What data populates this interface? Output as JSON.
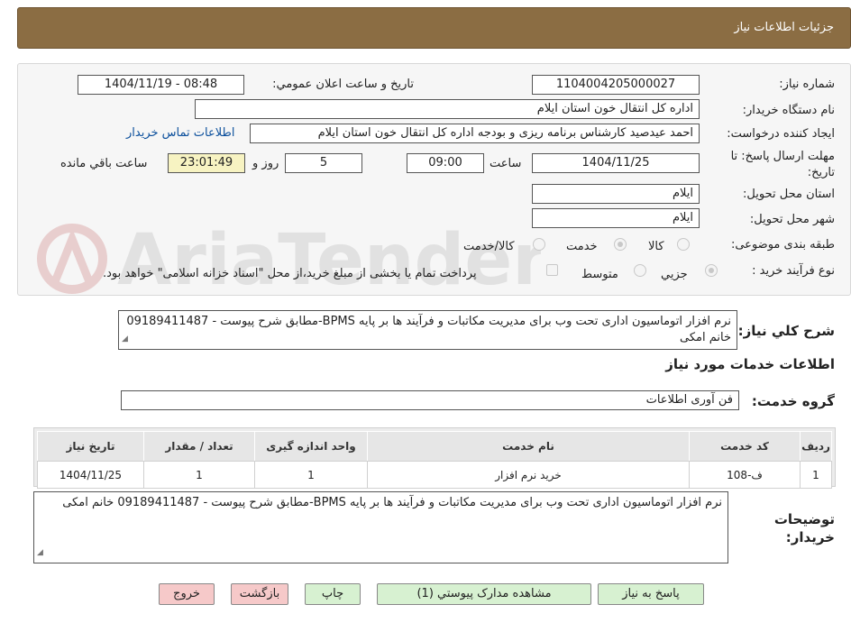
{
  "header": {
    "title": "جزئیات اطلاعات نیاز"
  },
  "form": {
    "need_number_label": "شماره نیاز:",
    "need_number": "1104004205000027",
    "announce_label": "تاریخ و ساعت اعلان عمومي:",
    "announce_value": "1404/11/19 - 08:48",
    "buyer_org_label": "نام دستگاه خریدار:",
    "buyer_org": "اداره کل انتقال خون استان ایلام",
    "requester_label": "ایجاد کننده درخواست:",
    "requester": "احمد عیدصید کارشناس برنامه ریزی و بودجه اداره کل انتقال خون استان ایلام",
    "contact_link": "اطلاعات تماس خریدار",
    "deadline_label": "مهلت ارسال پاسخ: تا تاریخ:",
    "deadline_date": "1404/11/25",
    "time_label": "ساعت",
    "deadline_time": "09:00",
    "days": "5",
    "days_label": "روز و",
    "remaining": "23:01:49",
    "remaining_label": "ساعت باقي مانده",
    "province_label": "استان محل تحویل:",
    "province": "ایلام",
    "city_label": "شهر محل تحویل:",
    "city": "ایلام",
    "category_label": "طبقه بندی موضوعی:",
    "category_options": [
      "کالا",
      "خدمت",
      "کالا/خدمت"
    ],
    "process_label": "نوع فرآیند خرید :",
    "process_options": [
      "جزیي",
      "متوسط"
    ],
    "payment_note": "پرداخت تمام یا بخشی از مبلغ خرید،از محل \"اسناد خزانه اسلامی\" خواهد بود."
  },
  "summary": {
    "label": "شرح کلي نیاز:",
    "text": "نرم افزار اتوماسیون اداری تحت وب برای مدیریت مکاتبات و فرآیند ها بر پایه BPMS-مطابق شرح پیوست - 09189411487 خانم امکی"
  },
  "services": {
    "section_title": "اطلاعات خدمات مورد نیاز",
    "group_label": "گروه خدمت:",
    "group_value": "فن آوری اطلاعات",
    "columns": [
      "ردیف",
      "کد خدمت",
      "نام خدمت",
      "واحد اندازه گیری",
      "تعداد / مقدار",
      "تاریخ نیاز"
    ],
    "rows": [
      [
        "1",
        "ف-108",
        "خرید نرم افزار",
        "1",
        "1",
        "1404/11/25"
      ]
    ]
  },
  "buyer_notes": {
    "label": "توضیحات خریدار:",
    "text": "نرم افزار اتوماسیون اداری تحت وب برای مدیریت مکاتبات و فرآیند ها بر پایه BPMS-مطابق شرح پیوست - 09189411487 خانم امکی"
  },
  "buttons": {
    "reply": "پاسخ به نیاز",
    "attachments": "مشاهده مدارک پیوستي (1)",
    "print": "چاپ",
    "back": "بازگشت",
    "exit": "خروج"
  },
  "colors": {
    "header_bg": "#8b6d43",
    "link": "#0b4f9c",
    "timer_bg": "#f7f3c2",
    "green_button": "#d7f1d1",
    "red_button": "#f6c9c9"
  },
  "watermark": "AriaTender.neT"
}
